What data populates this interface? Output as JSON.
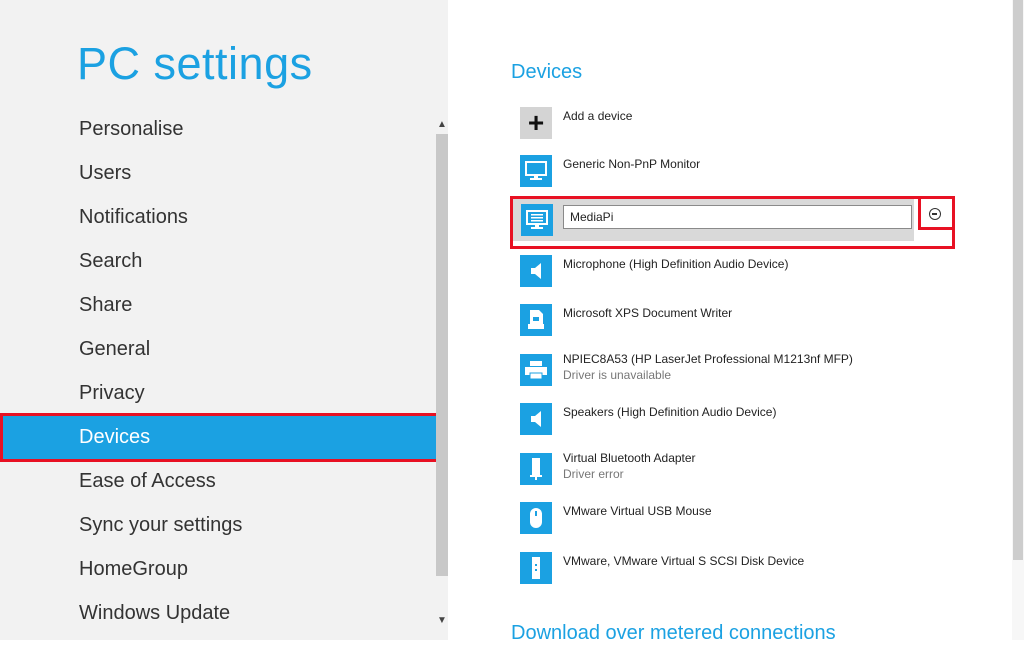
{
  "window": {
    "title": "PC settings"
  },
  "nav": {
    "items": [
      {
        "label": "Personalise"
      },
      {
        "label": "Users"
      },
      {
        "label": "Notifications"
      },
      {
        "label": "Search"
      },
      {
        "label": "Share"
      },
      {
        "label": "General"
      },
      {
        "label": "Privacy"
      },
      {
        "label": "Devices",
        "selected": true
      },
      {
        "label": "Ease of Access"
      },
      {
        "label": "Sync your settings"
      },
      {
        "label": "HomeGroup"
      },
      {
        "label": "Windows Update"
      }
    ]
  },
  "devices": {
    "title": "Devices",
    "add_label": "Add a device",
    "list": [
      {
        "name": "Generic Non-PnP Monitor",
        "icon": "monitor-icon"
      },
      {
        "name": "MediaPi",
        "icon": "monitor-icon",
        "editing": true
      },
      {
        "name": "Microphone (High Definition Audio Device)",
        "icon": "speaker-icon"
      },
      {
        "name": "Microsoft XPS Document Writer",
        "icon": "document-printer-icon"
      },
      {
        "name": "NPIEC8A53 (HP LaserJet Professional M1213nf MFP)",
        "status": "Driver is unavailable",
        "icon": "printer-icon"
      },
      {
        "name": "Speakers (High Definition Audio Device)",
        "icon": "speaker-icon"
      },
      {
        "name": "Virtual Bluetooth Adapter",
        "status": "Driver error",
        "icon": "usb-drive-icon"
      },
      {
        "name": "VMware Virtual USB Mouse",
        "icon": "mouse-icon"
      },
      {
        "name": "VMware, VMware Virtual S SCSI Disk Device",
        "icon": "disk-icon"
      }
    ]
  },
  "next_section": {
    "title": "Download over metered connections"
  },
  "colors": {
    "accent": "#1ba1e2",
    "highlight": "#e81123",
    "sidebar_bg": "#f2f2f2"
  }
}
